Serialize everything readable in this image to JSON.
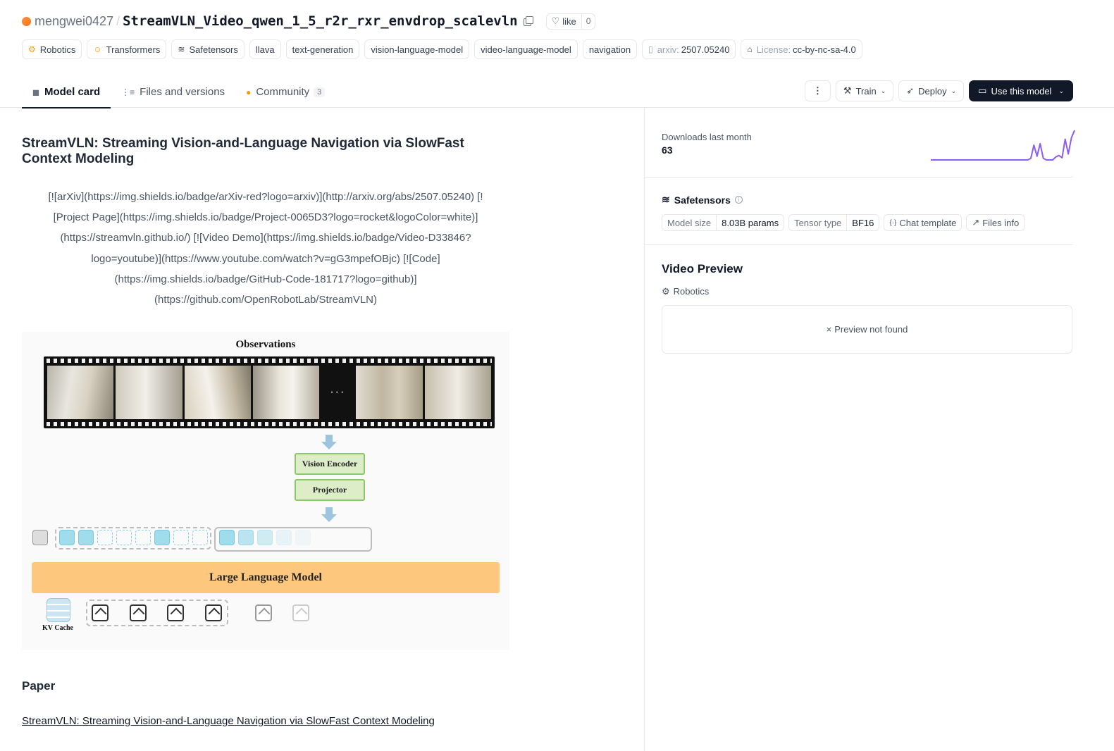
{
  "repo": {
    "owner": "mengwei0427",
    "name": "StreamVLN_Video_qwen_1_5_r2r_rxr_envdrop_scalevln",
    "like_label": "like",
    "like_count": "0"
  },
  "tags": [
    {
      "icon": "robotics-icon",
      "label": "Robotics"
    },
    {
      "icon": "transformers-icon",
      "label": "Transformers"
    },
    {
      "icon": "safetensors-icon",
      "label": "Safetensors"
    },
    {
      "icon": "",
      "label": "llava"
    },
    {
      "icon": "",
      "label": "text-generation"
    },
    {
      "icon": "",
      "label": "vision-language-model"
    },
    {
      "icon": "",
      "label": "video-language-model"
    },
    {
      "icon": "",
      "label": "navigation"
    }
  ],
  "arxiv_tag": {
    "prefix": "arxiv:",
    "value": "2507.05240"
  },
  "license_tag": {
    "prefix": "License:",
    "value": "cc-by-nc-sa-4.0"
  },
  "tabs": [
    {
      "label": "Model card",
      "active": true
    },
    {
      "label": "Files and versions",
      "active": false
    },
    {
      "label": "Community",
      "badge": "3",
      "active": false
    }
  ],
  "actions": {
    "train": "Train",
    "deploy": "Deploy",
    "use": "Use this model"
  },
  "main": {
    "heading": "StreamVLN: Streaming Vision-and-Language Navigation via SlowFast Context Modeling",
    "badges_lines": [
      "[![arXiv](https://img.shields.io/badge/arXiv-red?logo=arxiv)](http://arxiv.org/abs/2507.05240) [!",
      "[Project Page](https://img.shields.io/badge/Project-0065D3?logo=rocket&logoColor=white)]",
      "(https://streamvln.github.io/) [![Video Demo](https://img.shields.io/badge/Video-D33846?",
      "logo=youtube)](https://www.youtube.com/watch?v=gG3mpefOBjc) [![Code]",
      "(https://img.shields.io/badge/GitHub-Code-181717?logo=github)]",
      "(https://github.com/OpenRobotLab/StreamVLN)"
    ],
    "figure": {
      "title": "Observations",
      "dots": "···",
      "vision_encoder": "Vision Encoder",
      "projector": "Projector",
      "llm": "Large Language Model",
      "kv_cache": "KV Cache"
    },
    "paper_heading": "Paper",
    "paper_link": "StreamVLN: Streaming Vision-and-Language Navigation via SlowFast Context Modeling"
  },
  "sidebar": {
    "downloads_label": "Downloads last month",
    "downloads_value": "63",
    "downloads_trend": [
      0,
      0,
      0,
      0,
      0,
      0,
      0,
      0,
      0,
      0,
      0,
      0,
      0,
      0,
      0,
      0,
      0,
      0,
      0,
      0,
      0,
      0,
      0,
      0,
      0,
      0,
      0,
      0,
      0,
      0,
      0,
      0,
      2,
      20,
      5,
      22,
      2,
      0,
      0,
      0,
      4,
      6,
      3,
      28,
      8,
      30,
      40
    ],
    "safetensors_label": "Safetensors",
    "model_size_label": "Model size",
    "model_size_value": "8.03B params",
    "tensor_type_label": "Tensor type",
    "tensor_type_value": "BF16",
    "chat_template": "Chat template",
    "files_info": "Files info",
    "video_preview_title": "Video Preview",
    "video_preview_tag": "Robotics",
    "preview_not_found": "Preview not found"
  },
  "colors": {
    "accent_dark": "#111827",
    "spark_line": "#8b5cf6"
  }
}
